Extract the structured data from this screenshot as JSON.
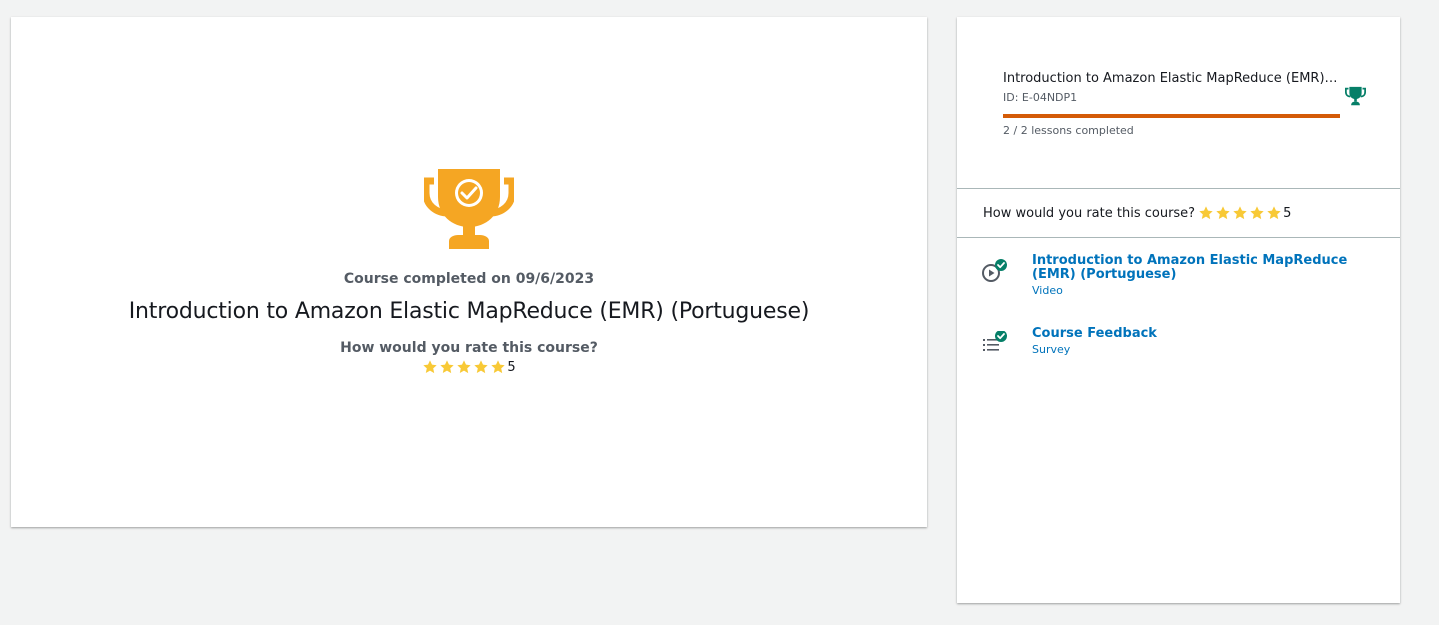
{
  "main": {
    "completed_text": "Course completed on 09/6/2023",
    "course_title": "Introduction to Amazon Elastic MapReduce (EMR) (Portuguese)",
    "rate_question": "How would you rate this course?",
    "rating": 5,
    "rating_text": "5",
    "trophy_color": "#f5a623"
  },
  "sidebar": {
    "course_title": "Introduction to Amazon Elastic MapReduce (EMR) (Portuguese)",
    "course_id": "ID: E-04NDP1",
    "progress_fraction": 1.0,
    "progress_color": "#d45b07",
    "lessons_completed": "2 / 2 lessons completed",
    "trophy_color": "#067f68",
    "rate_question": "How would you rate this course?",
    "rating_text": "5",
    "lessons": [
      {
        "title": "Introduction to Amazon Elastic MapReduce (EMR) (Portuguese)",
        "type": "Video",
        "icon": "play-circle-icon",
        "completed": true
      },
      {
        "title": "Course Feedback",
        "type": "Survey",
        "icon": "list-icon",
        "completed": true
      }
    ]
  },
  "colors": {
    "star": "#f8c936",
    "check": "#067f68",
    "link": "#0073bb"
  }
}
